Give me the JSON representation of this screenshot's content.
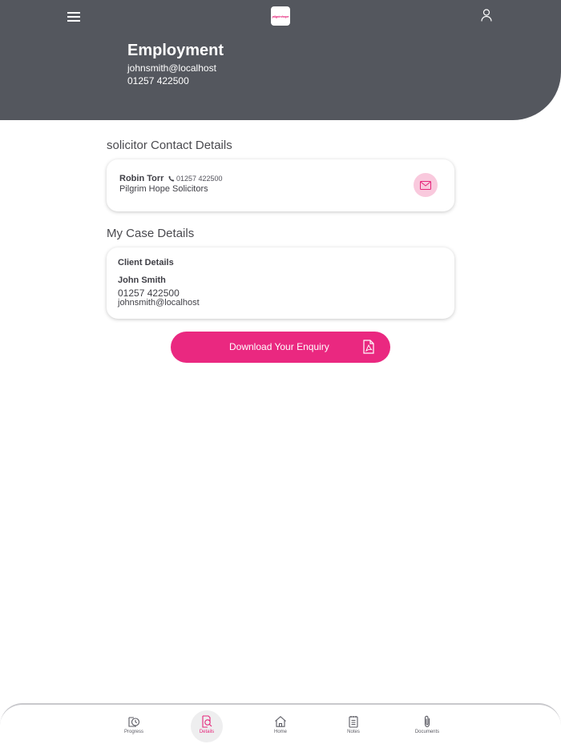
{
  "header": {
    "title": "Employment",
    "email": "johnsmith@localhost",
    "phone": "01257 422500",
    "logo_text": "pilgrimhope"
  },
  "solicitor_section": {
    "title": "solicitor Contact Details",
    "name": "Robin Torr",
    "phone": "01257 422500",
    "firm": "Pilgrim Hope Solicitors"
  },
  "case_section": {
    "title": "My Case Details",
    "client_heading": "Client Details",
    "client_name": "John Smith",
    "client_phone": "01257 422500",
    "client_email": "johnsmith@localhost"
  },
  "download_button": {
    "label": "Download Your Enquiry"
  },
  "bottom_nav": {
    "items": [
      {
        "label": "Progress",
        "icon": "progress-icon"
      },
      {
        "label": "Details",
        "icon": "details-icon",
        "active": true
      },
      {
        "label": "Home",
        "icon": "home-icon"
      },
      {
        "label": "Notes",
        "icon": "notes-icon"
      },
      {
        "label": "Documents",
        "icon": "documents-icon"
      }
    ]
  },
  "colors": {
    "header_bg": "#54575e",
    "accent": "#ea2880",
    "mail_bg": "#f9c9dd"
  }
}
